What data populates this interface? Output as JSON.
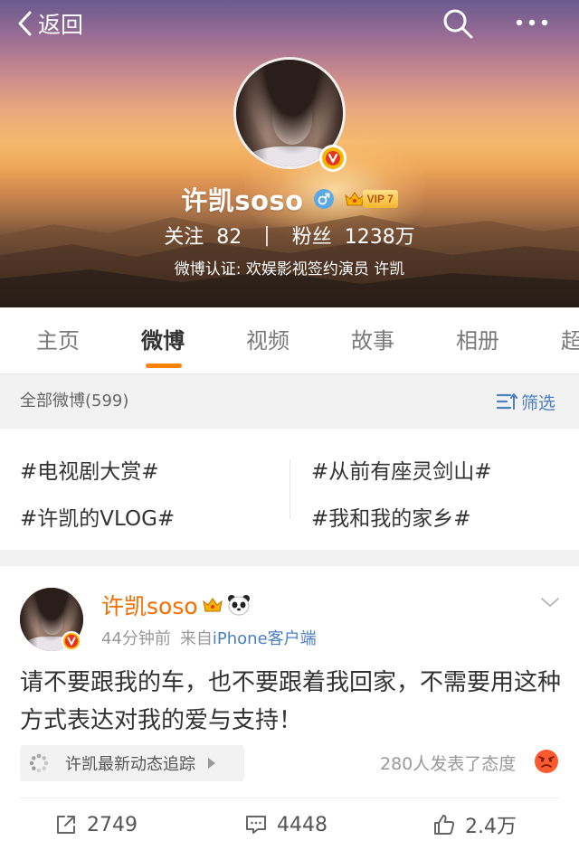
{
  "header": {
    "back_label": "返回",
    "back_icon": "chevron-left-icon",
    "search_icon": "search-icon",
    "more_icon": "more-dots-icon"
  },
  "profile": {
    "name": "许凯soso",
    "gender_icon": "male-icon",
    "vip_level": "VIP 7",
    "following_label": "关注",
    "following_count": "82",
    "followers_label": "粉丝",
    "followers_count": "1238万",
    "verification": "微博认证: 欢娱影视签约演员 许凯",
    "verified_badge_color": "#f7b500"
  },
  "tabs": [
    {
      "label": "主页",
      "active": false
    },
    {
      "label": "微博",
      "active": true
    },
    {
      "label": "视频",
      "active": false
    },
    {
      "label": "故事",
      "active": false
    },
    {
      "label": "相册",
      "active": false
    },
    {
      "label": "超",
      "active": false
    }
  ],
  "accent_color": "#ff8200",
  "filter": {
    "title": "全部微博(599)",
    "button_label": "筛选"
  },
  "topics": [
    "#电视剧大赏#",
    "#从前有座灵剑山#",
    "#许凯的VLOG#",
    "#我和我的家乡#"
  ],
  "post": {
    "author": "许凯soso",
    "time": "44分钟前",
    "source_prefix": "来自",
    "source_client": "iPhone客户端",
    "text": "请不要跟我的车，也不要跟着我回家，不需要用这种方式表达对我的爱与支持！",
    "track_label": "许凯最新动态追踪",
    "attitude_text": "280人发表了态度",
    "reposts": "2749",
    "comments": "4448",
    "likes": "2.4万"
  }
}
